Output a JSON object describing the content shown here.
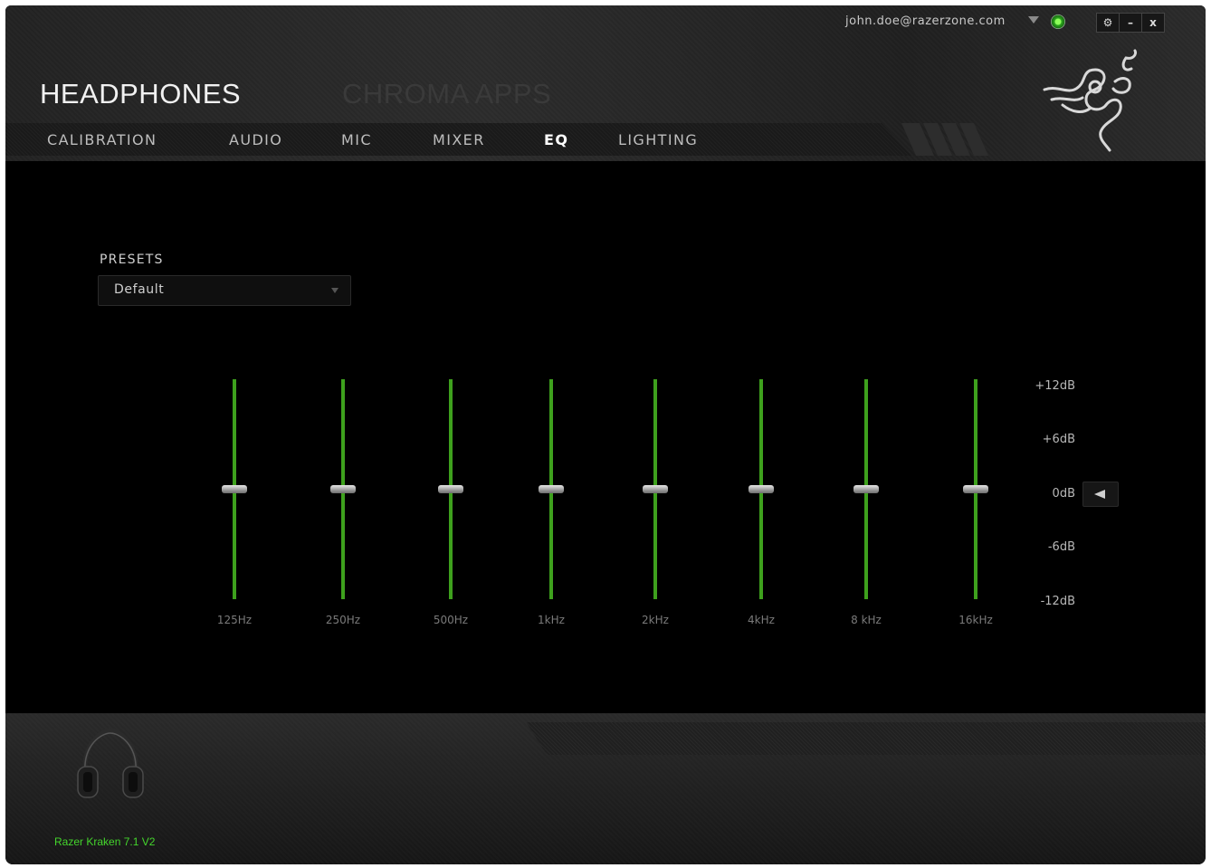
{
  "account": {
    "email": "john.doe@razerzone.com"
  },
  "window_buttons": [
    {
      "name": "settings-button",
      "glyph": "⚙"
    },
    {
      "name": "minimize-button",
      "glyph": "–"
    },
    {
      "name": "close-button",
      "glyph": "x"
    }
  ],
  "header": {
    "title": "HEADPHONES",
    "chroma_apps": "CHROMA APPS"
  },
  "tabs": [
    {
      "label": "CALIBRATION",
      "active": false
    },
    {
      "label": "AUDIO",
      "active": false
    },
    {
      "label": "MIC",
      "active": false
    },
    {
      "label": "MIXER",
      "active": false
    },
    {
      "label": "EQ",
      "active": true
    },
    {
      "label": "LIGHTING",
      "active": false
    }
  ],
  "presets": {
    "label": "PRESETS",
    "value": "Default"
  },
  "eq": {
    "bands": [
      {
        "label": "125Hz",
        "gain_db": 0
      },
      {
        "label": "250Hz",
        "gain_db": 0
      },
      {
        "label": "500Hz",
        "gain_db": 0
      },
      {
        "label": "1kHz",
        "gain_db": 0
      },
      {
        "label": "2kHz",
        "gain_db": 0
      },
      {
        "label": "4kHz",
        "gain_db": 0
      },
      {
        "label": "8 kHz",
        "gain_db": 0
      },
      {
        "label": "16kHz",
        "gain_db": 0
      }
    ],
    "scale": [
      "+12dB",
      "+6dB",
      "0dB",
      "-6dB",
      "-12dB"
    ],
    "range_db": [
      -12,
      12
    ]
  },
  "device": {
    "name": "Razer Kraken 7.1 V2"
  },
  "colors": {
    "accent": "#44d62c",
    "slider_track": "#3ea11d"
  }
}
